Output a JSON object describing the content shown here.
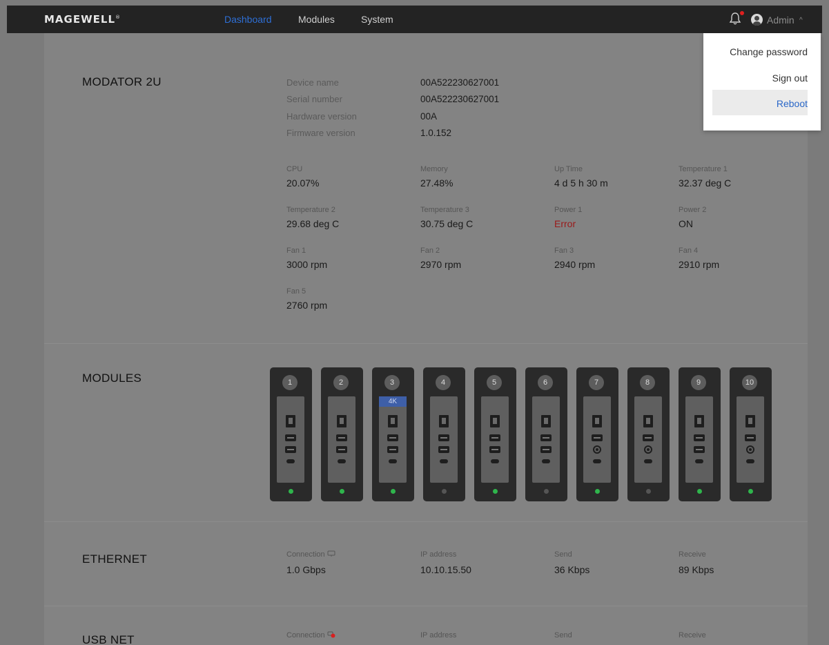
{
  "header": {
    "brand": "MAGEWELL",
    "brand_mark": "®",
    "nav": [
      {
        "label": "Dashboard",
        "active": true
      },
      {
        "label": "Modules",
        "active": false
      },
      {
        "label": "System",
        "active": false
      }
    ],
    "user_label": "Admin",
    "chevron": "^",
    "notification_color": "#e0201f"
  },
  "user_menu": {
    "items": [
      {
        "label": "Change password"
      },
      {
        "label": "Sign out"
      },
      {
        "label": "Reboot",
        "highlighted": true
      }
    ]
  },
  "device": {
    "title": "MODATOR 2U",
    "info": [
      {
        "label": "Device name",
        "value": "00A522230627001"
      },
      {
        "label": "Serial number",
        "value": "00A522230627001"
      },
      {
        "label": "Hardware version",
        "value": "00A"
      },
      {
        "label": "Firmware version",
        "value": "1.0.152"
      }
    ],
    "stats": [
      {
        "label": "CPU",
        "value": "20.07%"
      },
      {
        "label": "Memory",
        "value": "27.48%"
      },
      {
        "label": "Up Time",
        "value": "4 d 5 h 30 m"
      },
      {
        "label": "Temperature 1",
        "value": "32.37 deg C"
      },
      {
        "label": "Temperature 2",
        "value": "29.68 deg C"
      },
      {
        "label": "Temperature 3",
        "value": "30.75 deg C"
      },
      {
        "label": "Power 1",
        "value": "Error",
        "status": "error"
      },
      {
        "label": "Power 2",
        "value": "ON"
      },
      {
        "label": "Fan 1",
        "value": "3000 rpm"
      },
      {
        "label": "Fan 2",
        "value": "2970 rpm"
      },
      {
        "label": "Fan 3",
        "value": "2940 rpm"
      },
      {
        "label": "Fan 4",
        "value": "2910 rpm"
      },
      {
        "label": "Fan 5",
        "value": "2760 rpm"
      }
    ]
  },
  "modules": {
    "title": "MODULES",
    "badge_4k": "4K",
    "slots": [
      {
        "number": "1",
        "led": "on",
        "third_port": "a",
        "badge": false
      },
      {
        "number": "2",
        "led": "on",
        "third_port": "a",
        "badge": false
      },
      {
        "number": "3",
        "led": "on",
        "third_port": "a",
        "badge": true
      },
      {
        "number": "4",
        "led": "off",
        "third_port": "a",
        "badge": false
      },
      {
        "number": "5",
        "led": "on",
        "third_port": "a",
        "badge": false
      },
      {
        "number": "6",
        "led": "off",
        "third_port": "a",
        "badge": false
      },
      {
        "number": "7",
        "led": "on",
        "third_port": "o",
        "badge": false
      },
      {
        "number": "8",
        "led": "off",
        "third_port": "o",
        "badge": false
      },
      {
        "number": "9",
        "led": "on",
        "third_port": "a",
        "badge": false
      },
      {
        "number": "10",
        "led": "on",
        "third_port": "o",
        "badge": false
      }
    ]
  },
  "ethernet": {
    "title": "ETHERNET",
    "stats": [
      {
        "label": "Connection",
        "value": "1.0 Gbps"
      },
      {
        "label": "IP address",
        "value": "10.10.15.50"
      },
      {
        "label": "Send",
        "value": "36 Kbps"
      },
      {
        "label": "Receive",
        "value": "89 Kbps"
      }
    ]
  },
  "usbnet": {
    "title": "USB NET",
    "stats": [
      {
        "label": "Connection"
      },
      {
        "label": "IP address"
      },
      {
        "label": "Send"
      },
      {
        "label": "Receive"
      }
    ]
  },
  "colors": {
    "accent": "#2e6fd6",
    "error": "#9a1a1a",
    "led_on": "#2fb54c",
    "badge_4k": "#3e5fa8"
  }
}
